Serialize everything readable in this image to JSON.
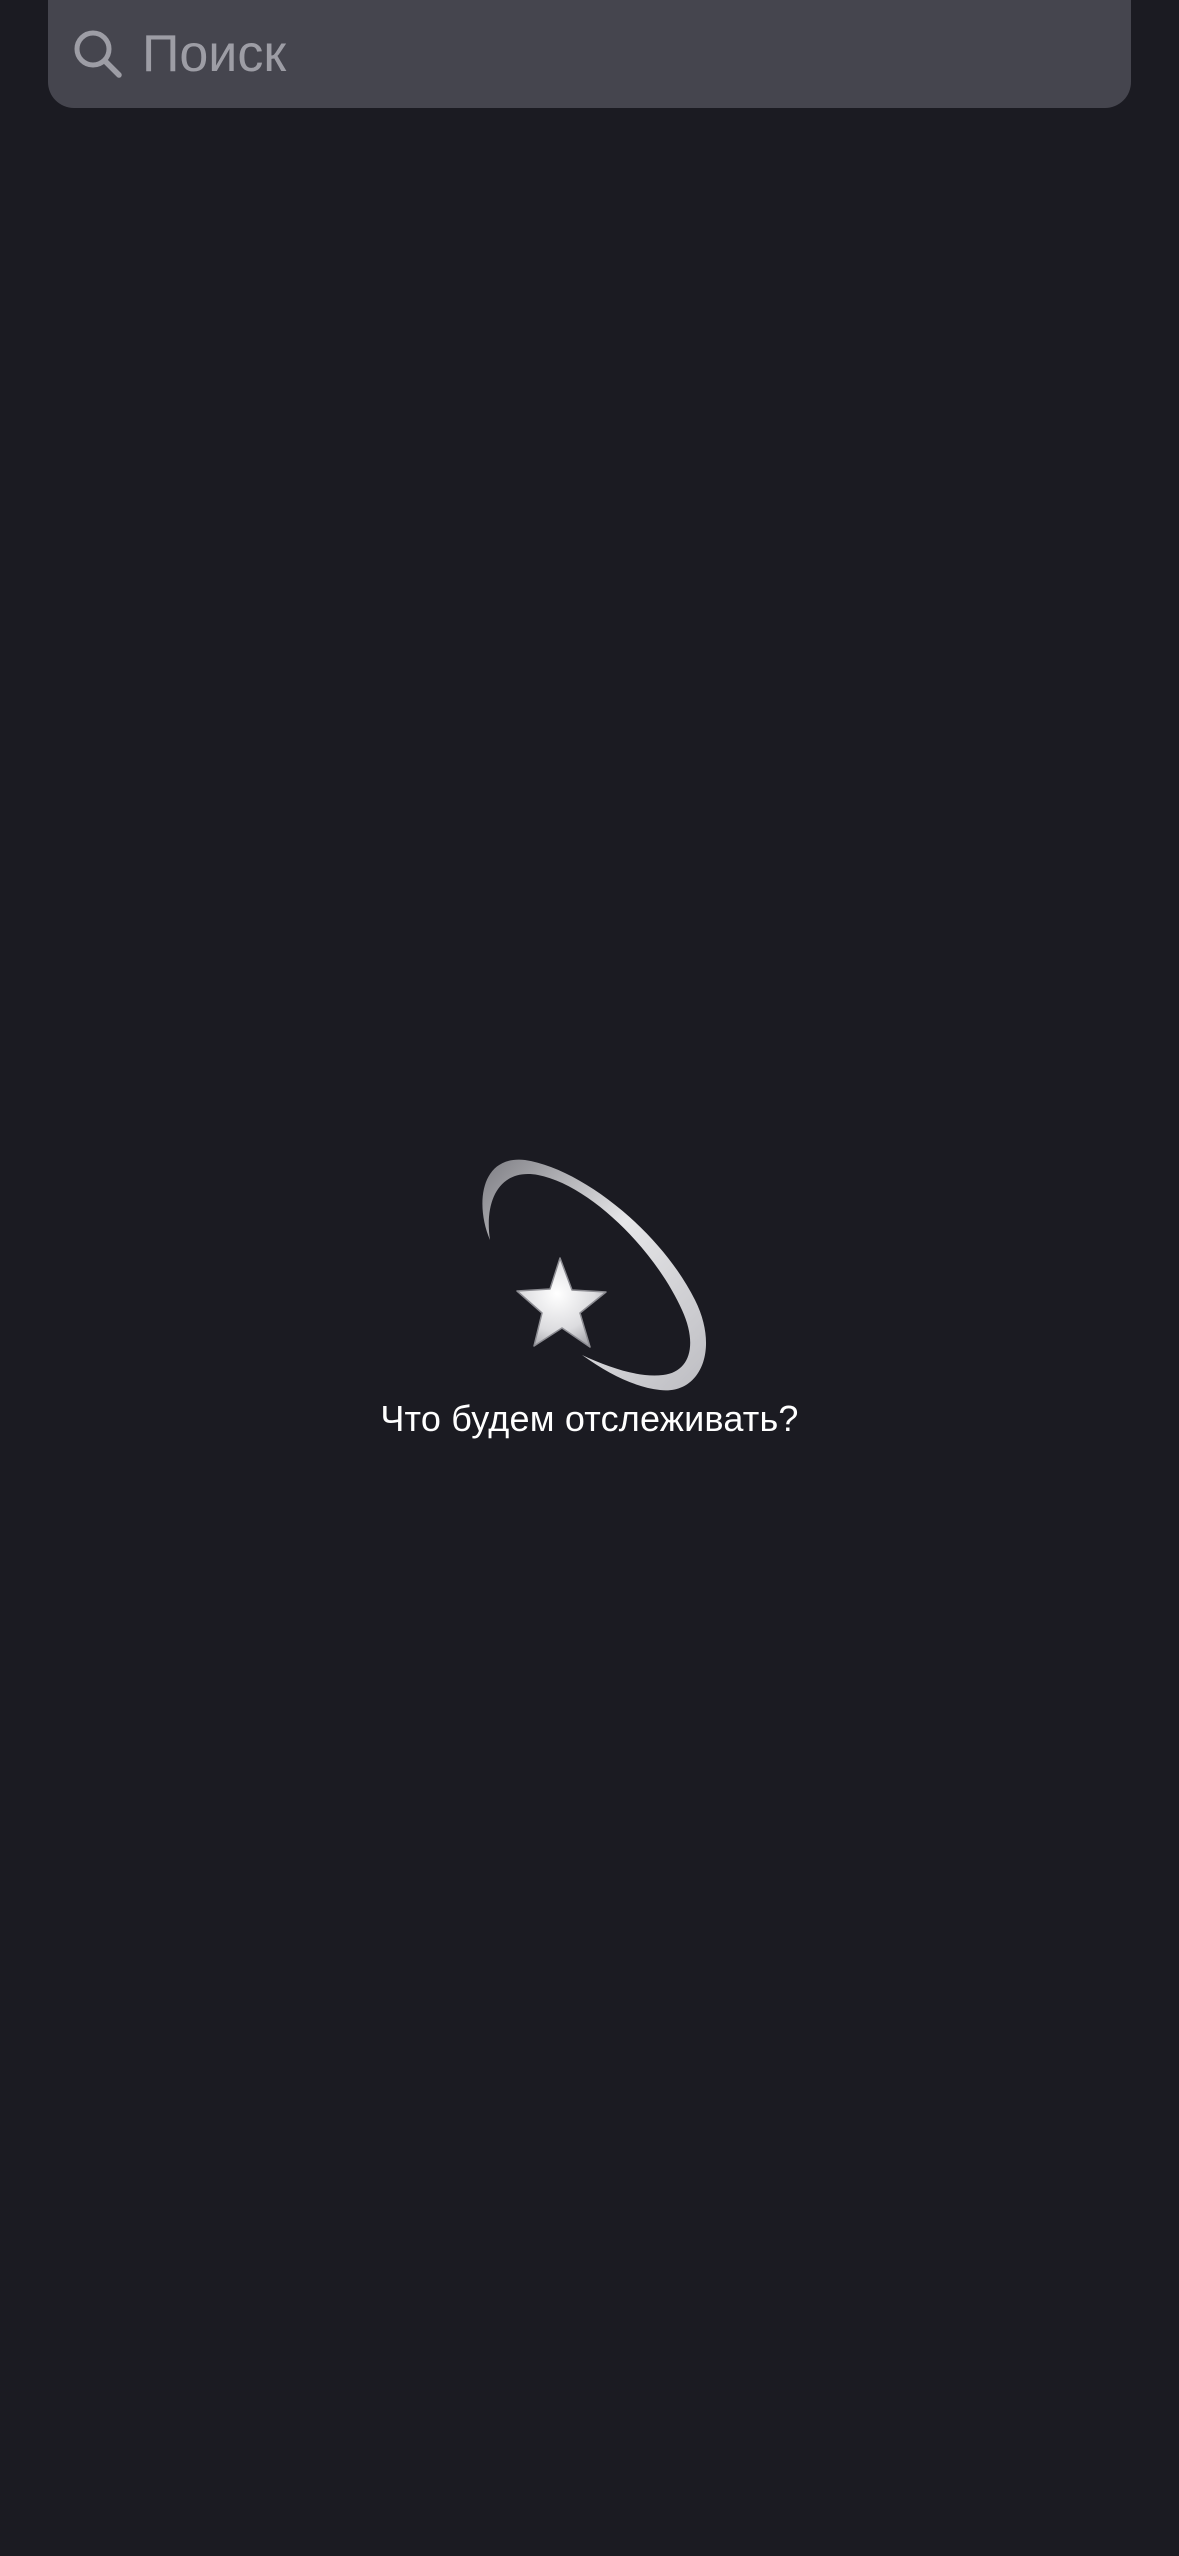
{
  "search": {
    "placeholder": "Поиск",
    "icon": "search-icon"
  },
  "empty_state": {
    "icon": "shooting-star-icon",
    "message": "Что будем отслеживать?"
  },
  "colors": {
    "background": "#1b1b22",
    "search_bar": "#45454e",
    "placeholder": "#9d9da5",
    "text": "#ffffff"
  }
}
